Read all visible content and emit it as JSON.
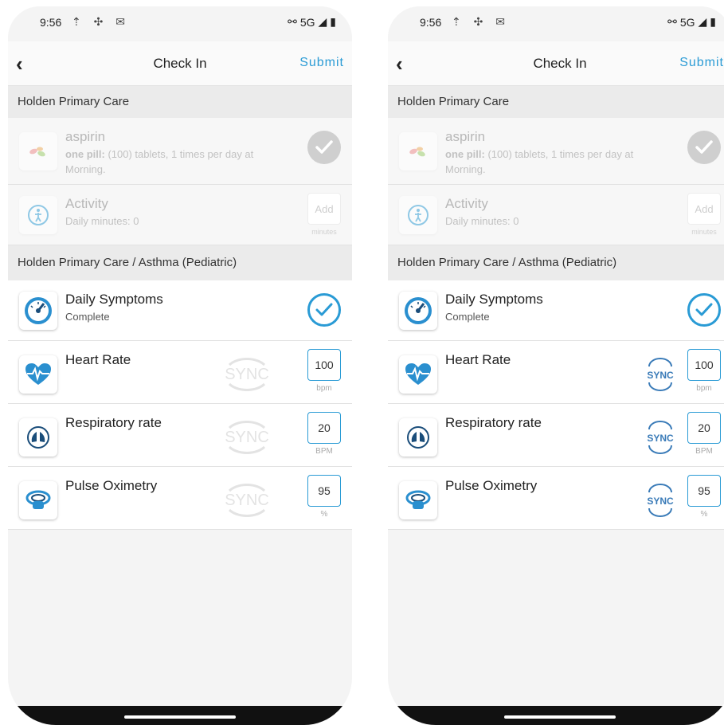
{
  "status": {
    "time": "9:56",
    "network": "5G"
  },
  "nav": {
    "title": "Check In",
    "submit": "Submit",
    "back": "‹"
  },
  "sections": {
    "primary": "Holden Primary Care",
    "asthma": "Holden Primary Care / Asthma (Pediatric)"
  },
  "aspirin": {
    "title": "aspirin",
    "sub_bold": "one pill:",
    "sub_rest": " (100) tablets, 1 times per day at Morning."
  },
  "activity": {
    "title": "Activity",
    "sub": "Daily minutes: 0",
    "add": "Add",
    "unit": "minutes"
  },
  "symptoms": {
    "title": "Daily Symptoms",
    "sub": "Complete"
  },
  "heart": {
    "title": "Heart Rate",
    "value": "100",
    "unit": "bpm"
  },
  "resp": {
    "title": "Respiratory rate",
    "value": "20",
    "unit": "BPM"
  },
  "pulse": {
    "title": "Pulse Oximetry",
    "value": "95",
    "unit": "%"
  },
  "sync_label": "SYNC",
  "colors": {
    "accent": "#2a9bd5",
    "sync_active": "#3a7bb8"
  }
}
